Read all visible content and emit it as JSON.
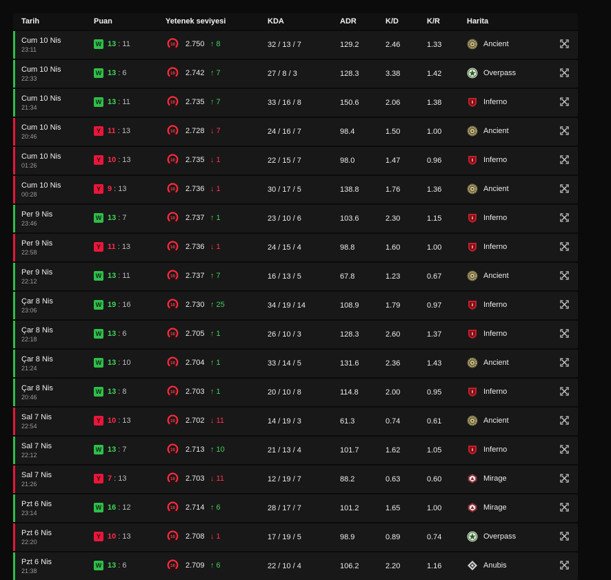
{
  "colors": {
    "win": "#2fbe4a",
    "loss": "#e8163a",
    "row_bg": "#181818",
    "page_bg": "#0b0b0b"
  },
  "header": {
    "date": "Tarih",
    "score": "Puan",
    "skill": "Yetenek seviyesi",
    "kda": "KDA",
    "adr": "ADR",
    "kd": "K/D",
    "kr": "K/R",
    "map": "Harita"
  },
  "level_icon": "skill-level-10-icon",
  "matches": [
    {
      "result": "win",
      "badge": "W",
      "date": "Cum 10 Nis",
      "time": "23:11",
      "mine": "13",
      "opp": "11",
      "elo": "2.750",
      "change": "↑ 8",
      "dir": "up",
      "kda": "32 / 13 / 7",
      "adr": "129.2",
      "kd": "2.46",
      "kr": "1.33",
      "map": "Ancient",
      "map_icon": "ancient"
    },
    {
      "result": "win",
      "badge": "W",
      "date": "Cum 10 Nis",
      "time": "22:33",
      "mine": "13",
      "opp": "6",
      "elo": "2.742",
      "change": "↑ 7",
      "dir": "up",
      "kda": "27 / 8 / 3",
      "adr": "128.3",
      "kd": "3.38",
      "kr": "1.42",
      "map": "Overpass",
      "map_icon": "overpass"
    },
    {
      "result": "win",
      "badge": "W",
      "date": "Cum 10 Nis",
      "time": "21:34",
      "mine": "13",
      "opp": "11",
      "elo": "2.735",
      "change": "↑ 7",
      "dir": "up",
      "kda": "33 / 16 / 8",
      "adr": "150.6",
      "kd": "2.06",
      "kr": "1.38",
      "map": "Inferno",
      "map_icon": "inferno"
    },
    {
      "result": "loss",
      "badge": "Y",
      "date": "Cum 10 Nis",
      "time": "20:46",
      "mine": "11",
      "opp": "13",
      "elo": "2.728",
      "change": "↓ 7",
      "dir": "down",
      "kda": "24 / 16 / 7",
      "adr": "98.4",
      "kd": "1.50",
      "kr": "1.00",
      "map": "Ancient",
      "map_icon": "ancient"
    },
    {
      "result": "loss",
      "badge": "Y",
      "date": "Cum 10 Nis",
      "time": "01:26",
      "mine": "10",
      "opp": "13",
      "elo": "2.735",
      "change": "↓ 1",
      "dir": "down",
      "kda": "22 / 15 / 7",
      "adr": "98.0",
      "kd": "1.47",
      "kr": "0.96",
      "map": "Inferno",
      "map_icon": "inferno"
    },
    {
      "result": "loss",
      "badge": "Y",
      "date": "Cum 10 Nis",
      "time": "00:28",
      "mine": "9",
      "opp": "13",
      "elo": "2.736",
      "change": "↓ 1",
      "dir": "down",
      "kda": "30 / 17 / 5",
      "adr": "138.8",
      "kd": "1.76",
      "kr": "1.36",
      "map": "Ancient",
      "map_icon": "ancient"
    },
    {
      "result": "win",
      "badge": "W",
      "date": "Per 9 Nis",
      "time": "23:46",
      "mine": "13",
      "opp": "7",
      "elo": "2.737",
      "change": "↑ 1",
      "dir": "up",
      "kda": "23 / 10 / 6",
      "adr": "103.6",
      "kd": "2.30",
      "kr": "1.15",
      "map": "Inferno",
      "map_icon": "inferno"
    },
    {
      "result": "loss",
      "badge": "Y",
      "date": "Per 9 Nis",
      "time": "22:58",
      "mine": "11",
      "opp": "13",
      "elo": "2.736",
      "change": "↓ 1",
      "dir": "down",
      "kda": "24 / 15 / 4",
      "adr": "98.8",
      "kd": "1.60",
      "kr": "1.00",
      "map": "Inferno",
      "map_icon": "inferno"
    },
    {
      "result": "win",
      "badge": "W",
      "date": "Per 9 Nis",
      "time": "22:12",
      "mine": "13",
      "opp": "11",
      "elo": "2.737",
      "change": "↑ 7",
      "dir": "up",
      "kda": "16 / 13 / 5",
      "adr": "67.8",
      "kd": "1.23",
      "kr": "0.67",
      "map": "Ancient",
      "map_icon": "ancient"
    },
    {
      "result": "win",
      "badge": "W",
      "date": "Çar 8 Nis",
      "time": "23:06",
      "mine": "19",
      "opp": "16",
      "elo": "2.730",
      "change": "↑ 25",
      "dir": "up",
      "kda": "34 / 19 / 14",
      "adr": "108.9",
      "kd": "1.79",
      "kr": "0.97",
      "map": "Inferno",
      "map_icon": "inferno"
    },
    {
      "result": "win",
      "badge": "W",
      "date": "Çar 8 Nis",
      "time": "22:18",
      "mine": "13",
      "opp": "6",
      "elo": "2.705",
      "change": "↑ 1",
      "dir": "up",
      "kda": "26 / 10 / 3",
      "adr": "128.3",
      "kd": "2.60",
      "kr": "1.37",
      "map": "Inferno",
      "map_icon": "inferno"
    },
    {
      "result": "win",
      "badge": "W",
      "date": "Çar 8 Nis",
      "time": "21:24",
      "mine": "13",
      "opp": "10",
      "elo": "2.704",
      "change": "↑ 1",
      "dir": "up",
      "kda": "33 / 14 / 5",
      "adr": "131.6",
      "kd": "2.36",
      "kr": "1.43",
      "map": "Ancient",
      "map_icon": "ancient"
    },
    {
      "result": "win",
      "badge": "W",
      "date": "Çar 8 Nis",
      "time": "20:46",
      "mine": "13",
      "opp": "8",
      "elo": "2.703",
      "change": "↑ 1",
      "dir": "up",
      "kda": "20 / 10 / 8",
      "adr": "114.8",
      "kd": "2.00",
      "kr": "0.95",
      "map": "Inferno",
      "map_icon": "inferno"
    },
    {
      "result": "loss",
      "badge": "Y",
      "date": "Sal 7 Nis",
      "time": "22:54",
      "mine": "10",
      "opp": "13",
      "elo": "2.702",
      "change": "↓ 11",
      "dir": "down",
      "kda": "14 / 19 / 3",
      "adr": "61.3",
      "kd": "0.74",
      "kr": "0.61",
      "map": "Ancient",
      "map_icon": "ancient"
    },
    {
      "result": "win",
      "badge": "W",
      "date": "Sal 7 Nis",
      "time": "22:12",
      "mine": "13",
      "opp": "7",
      "elo": "2.713",
      "change": "↑ 10",
      "dir": "up",
      "kda": "21 / 13 / 4",
      "adr": "101.7",
      "kd": "1.62",
      "kr": "1.05",
      "map": "Inferno",
      "map_icon": "inferno"
    },
    {
      "result": "loss",
      "badge": "Y",
      "date": "Sal 7 Nis",
      "time": "21:26",
      "mine": "7",
      "opp": "13",
      "elo": "2.703",
      "change": "↓ 11",
      "dir": "down",
      "kda": "12 / 19 / 7",
      "adr": "88.2",
      "kd": "0.63",
      "kr": "0.60",
      "map": "Mirage",
      "map_icon": "mirage"
    },
    {
      "result": "win",
      "badge": "W",
      "date": "Pzt 6 Nis",
      "time": "23:14",
      "mine": "16",
      "opp": "12",
      "elo": "2.714",
      "change": "↑ 6",
      "dir": "up",
      "kda": "28 / 17 / 7",
      "adr": "101.2",
      "kd": "1.65",
      "kr": "1.00",
      "map": "Mirage",
      "map_icon": "mirage"
    },
    {
      "result": "loss",
      "badge": "Y",
      "date": "Pzt 6 Nis",
      "time": "22:20",
      "mine": "10",
      "opp": "13",
      "elo": "2.708",
      "change": "↓ 1",
      "dir": "down",
      "kda": "17 / 19 / 5",
      "adr": "98.9",
      "kd": "0.89",
      "kr": "0.74",
      "map": "Overpass",
      "map_icon": "overpass"
    },
    {
      "result": "win",
      "badge": "W",
      "date": "Pzt 6 Nis",
      "time": "21:38",
      "mine": "13",
      "opp": "6",
      "elo": "2.709",
      "change": "↑ 6",
      "dir": "up",
      "kda": "22 / 10 / 4",
      "adr": "106.2",
      "kd": "2.20",
      "kr": "1.16",
      "map": "Anubis",
      "map_icon": "anubis"
    }
  ]
}
